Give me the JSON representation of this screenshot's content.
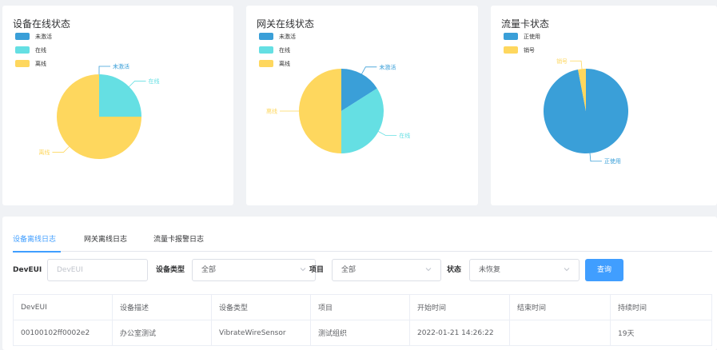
{
  "colors": {
    "inactive": "#3a9fd8",
    "online": "#65dfe3",
    "offline": "#fed75e",
    "accent": "#409eff"
  },
  "device_chart": {
    "title": "设备在线状态",
    "legend": [
      {
        "label": "未激活",
        "color": "#3a9fd8"
      },
      {
        "label": "在线",
        "color": "#65dfe3"
      },
      {
        "label": "离线",
        "color": "#fed75e"
      }
    ]
  },
  "gateway_chart": {
    "title": "网关在线状态",
    "legend": [
      {
        "label": "未激活",
        "color": "#3a9fd8"
      },
      {
        "label": "在线",
        "color": "#65dfe3"
      },
      {
        "label": "离线",
        "color": "#fed75e"
      }
    ]
  },
  "sim_chart": {
    "title": "流量卡状态",
    "legend": [
      {
        "label": "正使用",
        "color": "#3a9fd8"
      },
      {
        "label": "销号",
        "color": "#fed75e"
      }
    ]
  },
  "chart_data": [
    {
      "type": "pie",
      "title": "设备在线状态",
      "categories": [
        "未激活",
        "在线",
        "离线"
      ],
      "values": [
        0,
        25,
        75
      ],
      "colors": [
        "#3a9fd8",
        "#65dfe3",
        "#fed75e"
      ],
      "legend": "top-left"
    },
    {
      "type": "pie",
      "title": "网关在线状态",
      "categories": [
        "未激活",
        "在线",
        "离线"
      ],
      "values": [
        16,
        34,
        50
      ],
      "colors": [
        "#3a9fd8",
        "#65dfe3",
        "#fed75e"
      ],
      "legend": "top-left"
    },
    {
      "type": "pie",
      "title": "流量卡状态",
      "categories": [
        "正使用",
        "销号"
      ],
      "values": [
        97,
        3
      ],
      "colors": [
        "#3a9fd8",
        "#fed75e"
      ],
      "legend": "top-left"
    }
  ],
  "tabs": [
    {
      "label": "设备离线日志",
      "active": true
    },
    {
      "label": "网关离线日志",
      "active": false
    },
    {
      "label": "流量卡报警日志",
      "active": false
    }
  ],
  "filters": {
    "deveui_label": "DevEUI",
    "deveui_placeholder": "DevEUI",
    "device_type_label": "设备类型",
    "device_type_value": "全部",
    "project_label": "项目",
    "project_value": "全部",
    "status_label": "状态",
    "status_value": "未恢复",
    "query_label": "查询"
  },
  "table": {
    "headers": [
      "DevEUI",
      "设备描述",
      "设备类型",
      "项目",
      "开始时间",
      "结束时间",
      "持续时间"
    ],
    "rows": [
      [
        "00100102ff0002e2",
        "办公室测试",
        "VibrateWireSensor",
        "测试组织",
        "2022-01-21 14:26:22",
        "",
        "19天"
      ]
    ]
  }
}
